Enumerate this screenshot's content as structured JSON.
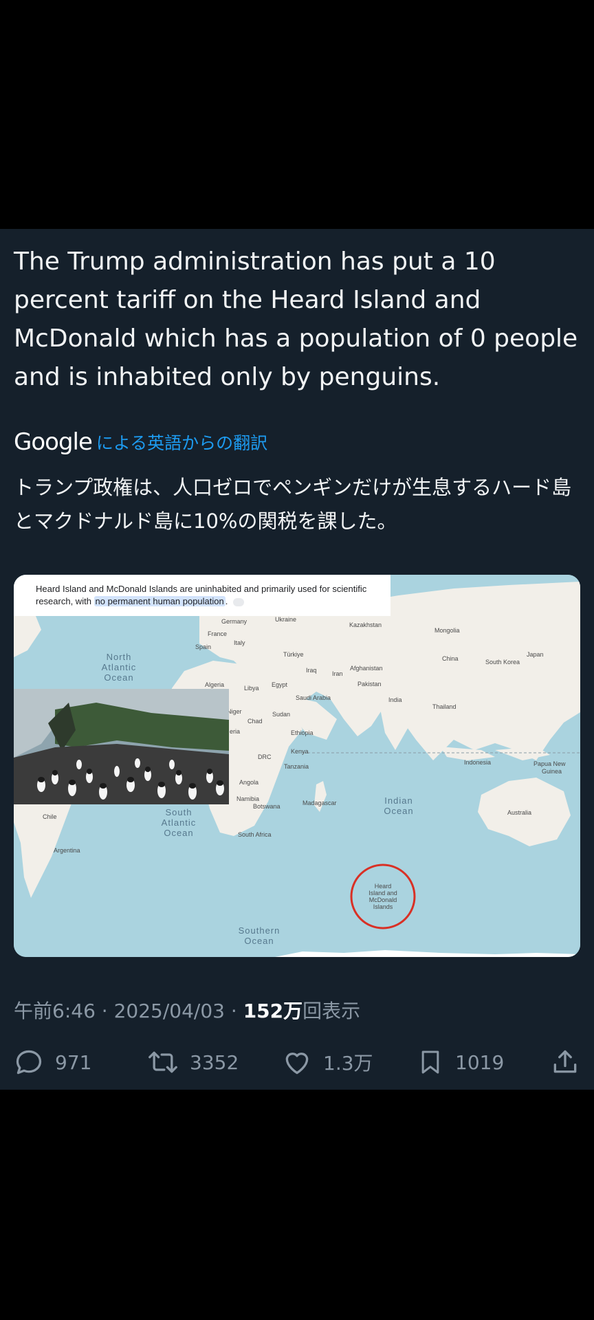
{
  "tweet": {
    "text": "The Trump administration has put a 10 percent tariff on the Heard Island and McDonald which has a population of 0 people and is inhabited only by penguins.",
    "google_logo": "Google",
    "translate_label": "による英語からの翻訳",
    "translation": "トランプ政権は、人口ゼロでペンギンだけが生息するハード島とマクドナルド島に10%の関税を課した。"
  },
  "media": {
    "caption_pre": "Heard Island and McDonald Islands are uninhabited and primarily used for scientific research, with ",
    "caption_highlight": "no permanent human population",
    "caption_post": ".",
    "map_labels": {
      "germany": "Germany",
      "ukraine": "Ukraine",
      "france": "France",
      "italy": "Italy",
      "spain": "Spain",
      "kazakhstan": "Kazakhstan",
      "mongolia": "Mongolia",
      "turkiye": "Türkiye",
      "iraq": "Iraq",
      "iran": "Iran",
      "afghanistan": "Afghanistan",
      "pakistan": "Pakistan",
      "china": "China",
      "south_korea": "South Korea",
      "japan": "Japan",
      "algeria": "Algeria",
      "libya": "Libya",
      "egypt": "Egypt",
      "saudi_arabia": "Saudi Arabia",
      "india": "India",
      "thailand": "Thailand",
      "niger": "Niger",
      "chad": "Chad",
      "sudan": "Sudan",
      "nigeria": "eria",
      "ethiopia": "Ethiopia",
      "kenya": "Kenya",
      "drc": "DRC",
      "tanzania": "Tanzania",
      "indonesia": "Indonesia",
      "png1": "Papua New",
      "png2": "Guinea",
      "angola": "Angola",
      "namibia": "Namibia",
      "botswana": "Botswana",
      "madagascar": "Madagascar",
      "australia": "Australia",
      "chile": "Chile",
      "south_africa": "South Africa",
      "argentina": "Argentina",
      "north_atlantic": [
        "North",
        "Atlantic",
        "Ocean"
      ],
      "south_atlantic": [
        "South",
        "Atlantic",
        "Ocean"
      ],
      "indian_ocean": [
        "Indian",
        "Ocean"
      ],
      "southern_ocean": [
        "Southern",
        "Ocean"
      ],
      "heard": [
        "Heard",
        "Island and",
        "McDonald",
        "Islands"
      ]
    }
  },
  "meta": {
    "time": "午前6:46",
    "sep1": " · ",
    "date": "2025/04/03",
    "sep2": " · ",
    "views_count": "152万",
    "views_label": "回表示"
  },
  "actions": {
    "replies": "971",
    "retweets": "3352",
    "likes": "1.3万",
    "bookmarks": "1019"
  },
  "colors": {
    "background": "#15202b",
    "link": "#1d9bf0",
    "muted": "#8b98a5",
    "ocean": "#aad3df",
    "land": "#f2efe9",
    "circle": "#d93025"
  }
}
